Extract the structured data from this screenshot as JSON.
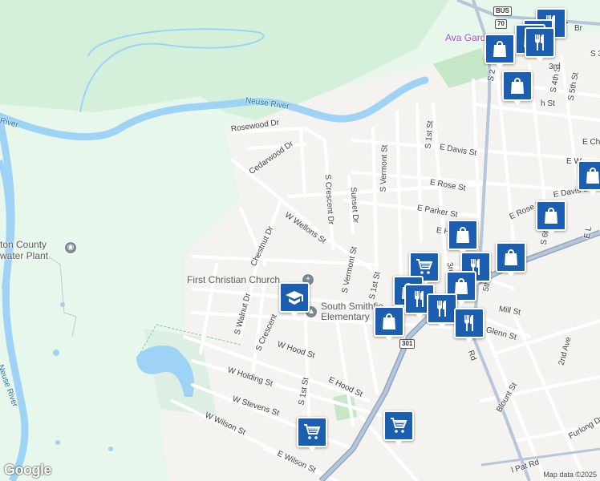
{
  "map": {
    "attribution": "Map data ©2025",
    "logo": "Google",
    "water_labels": {
      "river_1": "Neuse River",
      "river_2": "Neuse River",
      "river_3": "River"
    },
    "facility_label": "ton County\nwater Plant",
    "area_labels": {
      "ava": "Ava Gard"
    },
    "poi": {
      "church": "First Christian Church",
      "school_line1": "South Smithfie",
      "school_line2": "Elementary"
    },
    "shields": {
      "us70": "70",
      "us301": "301",
      "bus": "BUS"
    },
    "streets": {
      "rosewood": "Rosewood Dr",
      "cedarwood": "Cedarwood Dr",
      "s_crescent_dr_top": "S Crescent Dr",
      "sunset": "Sunset Dr",
      "s_vermont_top": "S Vermont St",
      "s_1st_top": "S 1st St",
      "e_davis": "E Davis St",
      "e_rose": "E Rose St",
      "w_wellons": "W Wellons St",
      "chestnut": "Chestnut Dr",
      "e_parker": "E Parker St",
      "s_vermont_mid": "S Vermont St",
      "s_1st_mid": "S 1st St",
      "e_ho": "E Ho",
      "third_s": "3rd",
      "fifth_s": "5th St",
      "mill": "Mill St",
      "glenn": "Glenn St",
      "s_walnut": "S Walnut Dr",
      "s_crescent_low": "S Crescent",
      "w_hood": "W Hood St",
      "e_hood": "E Hood St",
      "s_1st_low": "S 1st St",
      "w_holding": "W Holding St",
      "w_stevens": "W Stevens St",
      "w_wilson": "W Wilson St",
      "e_wilson": "E Wilson St",
      "blount": "Blount St",
      "second_ave": "2nd Ave",
      "furlong": "Furlong Dr",
      "rd": "Rd",
      "pat_rd": "l Pat Rd",
      "e_davis_right": "E Davis St",
      "e_rose_right": "E Rose St",
      "s_4th": "S 4th St",
      "s_5th": "S 5th St",
      "s_6th": "S 6th",
      "e_w": "E W",
      "e_ch": "E Ch",
      "e_l": "E L",
      "n4": "N 4",
      "br": "Br",
      "s2": "S 2",
      "th_st": "h St",
      "s3rd": "3rd",
      "s_3": "S 3"
    },
    "markers": [
      {
        "icon": "restaurant"
      },
      {
        "icon": "restaurant"
      },
      {
        "icon": "restaurant"
      },
      {
        "icon": "shopping-bag"
      },
      {
        "icon": "shopping-bag"
      },
      {
        "icon": "shopping-bag"
      },
      {
        "icon": "shopping-bag"
      },
      {
        "icon": "shopping-bag"
      },
      {
        "icon": "shopping-bag"
      },
      {
        "icon": "shopping-bag"
      },
      {
        "icon": "shopping-bag"
      },
      {
        "icon": "shopping-cart"
      },
      {
        "icon": "shopping-cart"
      },
      {
        "icon": "shopping-cart"
      },
      {
        "icon": "restaurant"
      },
      {
        "icon": "restaurant"
      },
      {
        "icon": "restaurant"
      },
      {
        "icon": "restaurant"
      },
      {
        "icon": "school"
      }
    ]
  }
}
